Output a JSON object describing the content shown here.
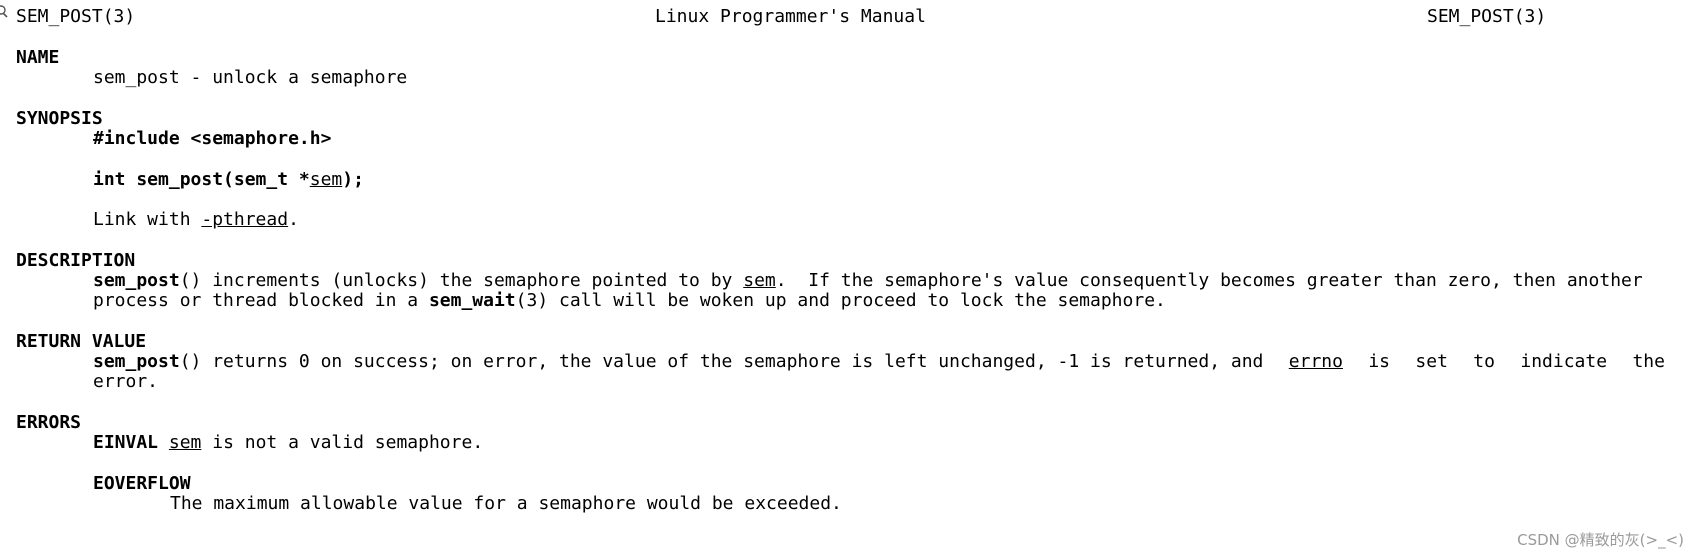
{
  "header": {
    "left": "SEM_POST(3)",
    "center": "Linux Programmer's Manual",
    "right": "SEM_POST(3)"
  },
  "name": {
    "heading": "NAME",
    "text": "sem_post - unlock a semaphore"
  },
  "synopsis": {
    "heading": "SYNOPSIS",
    "include": "#include <semaphore.h>",
    "proto_func": "int sem_post(sem_t *",
    "proto_arg": "sem",
    "proto_end": ");",
    "link_prefix": "Link with ",
    "link_flag": "-pthread",
    "link_suffix": "."
  },
  "description": {
    "heading": "DESCRIPTION",
    "l1_func": "sem_post",
    "l1_a": "() increments (unlocks) the semaphore pointed to by ",
    "l1_arg": "sem",
    "l1_b": ".  If the semaphore's value consequently becomes greater than zero, then another",
    "l2_a": "process or thread blocked in a ",
    "l2_func": "sem_wait",
    "l2_b": "(3) call will be woken up and proceed to lock the semaphore."
  },
  "return_value": {
    "heading": "RETURN VALUE",
    "l1_func": "sem_post",
    "l1_a": "() returns 0 on success; on error, the value of the semaphore is left unchanged, -1 is returned, and",
    "l1_errno": "errno",
    "l1_is": "is",
    "l1_set": "set",
    "l1_to": "to",
    "l1_indicate": "indicate",
    "l1_the": "the",
    "l2": "error."
  },
  "errors": {
    "heading": "ERRORS",
    "einval_name": "EINVAL",
    "einval_arg": "sem",
    "einval_text": " is not a valid semaphore.",
    "eoverflow_name": "EOVERFLOW",
    "eoverflow_text": "The maximum allowable value for a semaphore would be exceeded."
  },
  "watermark": "CSDN @精致的灰(>_<)"
}
